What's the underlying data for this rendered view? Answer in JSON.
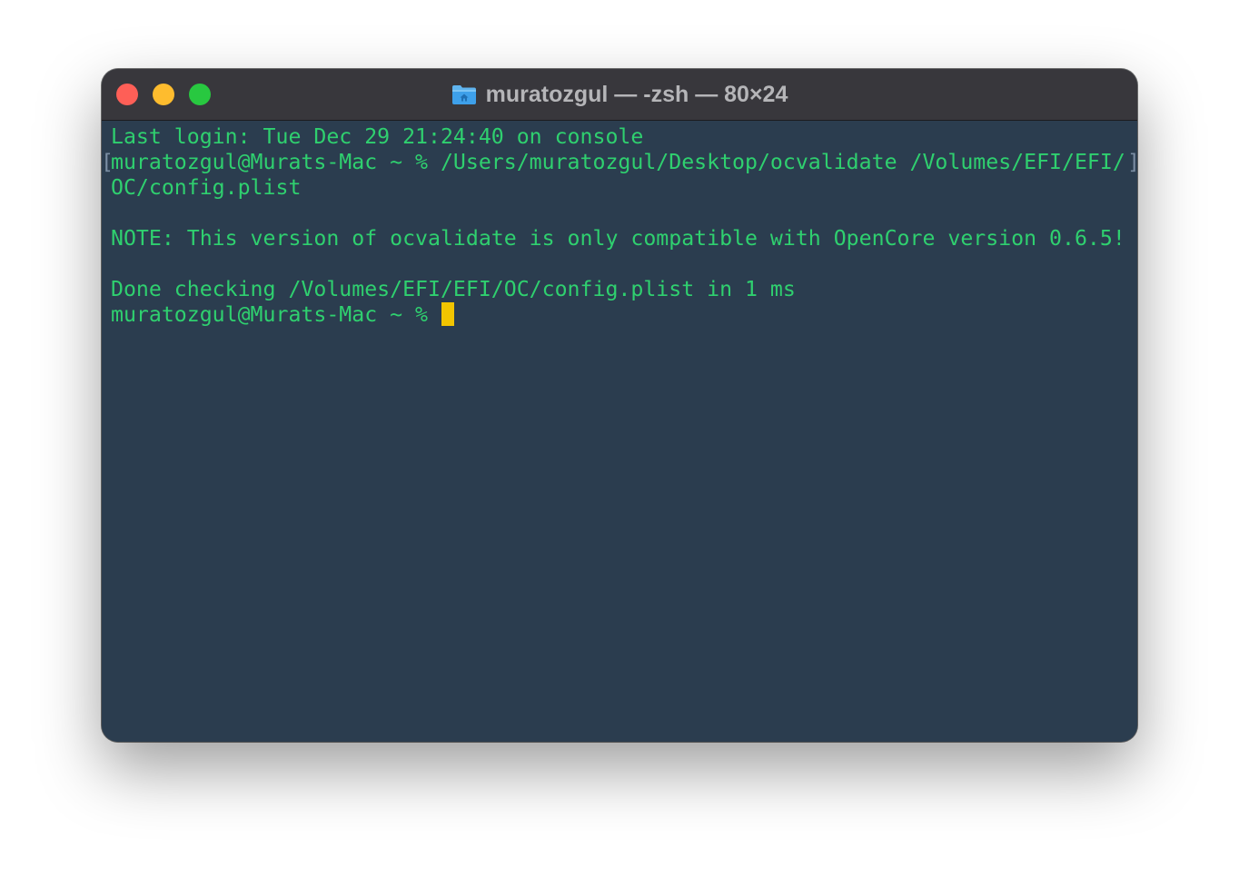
{
  "window": {
    "title": "muratozgul — -zsh — 80×24",
    "folder_icon": "home-folder-icon",
    "controls": {
      "close_color": "#fe5f57",
      "minimize_color": "#febc2e",
      "zoom_color": "#28c840"
    }
  },
  "terminal": {
    "background": "#2b3d4f",
    "text_color": "#2fd06f",
    "cursor_color": "#f2c500",
    "lines": [
      "Last login: Tue Dec 29 21:24:40 on console",
      "muratozgul@Murats-Mac ~ % /Users/muratozgul/Desktop/ocvalidate /Volumes/EFI/EFI/",
      "OC/config.plist",
      "",
      "NOTE: This version of ocvalidate is only compatible with OpenCore version 0.6.5!",
      "",
      "Done checking /Volumes/EFI/EFI/OC/config.plist in 1 ms",
      "muratozgul@Murats-Mac ~ % "
    ]
  }
}
